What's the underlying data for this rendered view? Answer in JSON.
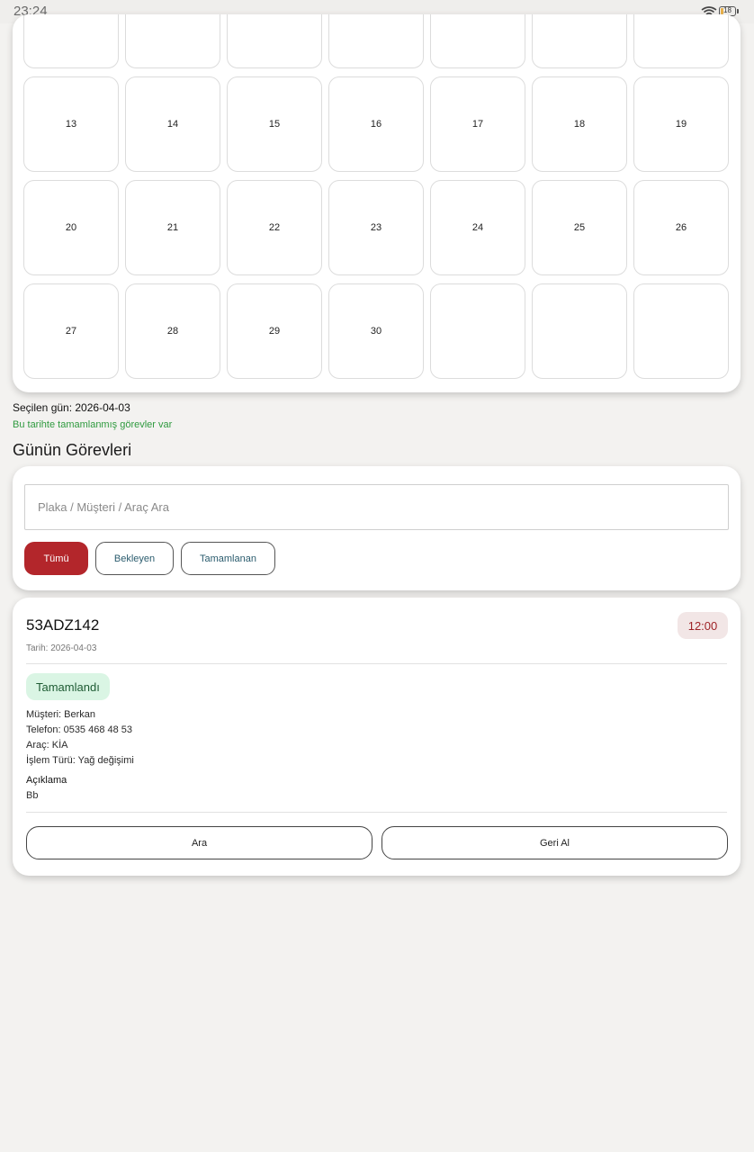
{
  "status_bar": {
    "time": "23:24",
    "battery_level": "18"
  },
  "calendar": {
    "rows": [
      [
        "",
        "",
        "",
        "",
        "",
        "",
        ""
      ],
      [
        "13",
        "14",
        "15",
        "16",
        "17",
        "18",
        "19"
      ],
      [
        "20",
        "21",
        "22",
        "23",
        "24",
        "25",
        "26"
      ],
      [
        "27",
        "28",
        "29",
        "30",
        "",
        "",
        ""
      ]
    ]
  },
  "selection": {
    "selected_day_text": "Seçilen gün: 2026-04-03",
    "completed_info": "Bu tarihte tamamlanmış görevler var"
  },
  "section_title": "Günün Görevleri",
  "filter": {
    "search_placeholder": "Plaka / Müşteri / Araç Ara",
    "search_value": "",
    "chips": {
      "all": "Tümü",
      "pending": "Bekleyen",
      "completed": "Tamamlanan"
    },
    "active_chip": "all"
  },
  "task": {
    "plate": "53ADZ142",
    "time": "12:00",
    "date_text": "Tarih: 2026-04-03",
    "status": "Tamamlandı",
    "customer": "Müşteri: Berkan",
    "phone": "Telefon: 0535 468 48 53",
    "vehicle": "Araç: KİA",
    "service_type": "İşlem Türü: Yağ değişimi",
    "description_label": "Açıklama",
    "description": "Bb",
    "call_button": "Ara",
    "undo_button": "Geri Al"
  },
  "colors": {
    "accent": "#b3262b",
    "success_text": "#2f9a3f",
    "status_badge_bg": "#daf5e4",
    "time_badge_bg": "#f2e6e6"
  }
}
